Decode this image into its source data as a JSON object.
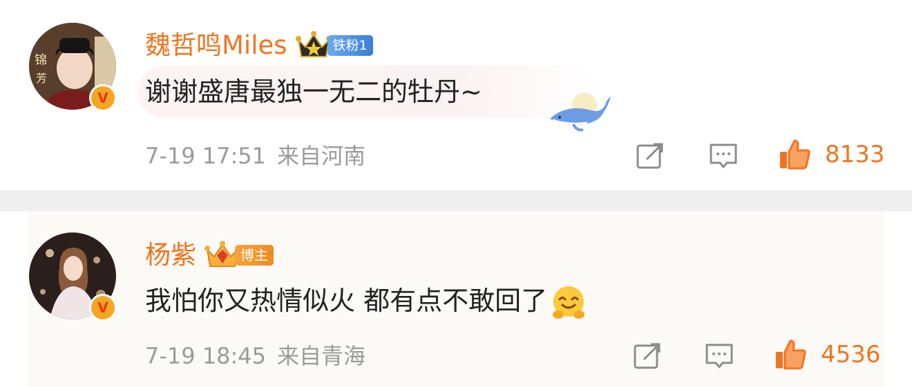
{
  "colors": {
    "username": "#f2741e",
    "like": "#f2741e",
    "meta": "#9a9a9a",
    "separator": "#efefef",
    "fan_badge": "#4a90e2",
    "blogger_badge": "#f08a1e"
  },
  "comments": [
    {
      "username": "魏哲鸣Miles",
      "badge_icon": "crown-icon",
      "badge_label": "铁粉1",
      "verified_icon": "verified-v-icon",
      "text": "谢谢盛唐最独一无二的牡丹~",
      "decoration_icon": "whale-icon",
      "date": "7-19 17:51",
      "location": "来自河南",
      "share_icon": "share-icon",
      "reply_icon": "comment-icon",
      "like_icon": "thumbs-up-icon",
      "likes": "8133"
    },
    {
      "username": "杨紫",
      "badge_icon": "crown-icon",
      "badge_label": "博主",
      "verified_icon": "verified-v-icon",
      "text": "我怕你又热情似火 都有点不敢回了",
      "emoji_icon": "hug-emoji-icon",
      "date": "7-19 18:45",
      "location": "来自青海",
      "share_icon": "share-icon",
      "reply_icon": "comment-icon",
      "like_icon": "thumbs-up-icon",
      "likes": "4536"
    }
  ]
}
